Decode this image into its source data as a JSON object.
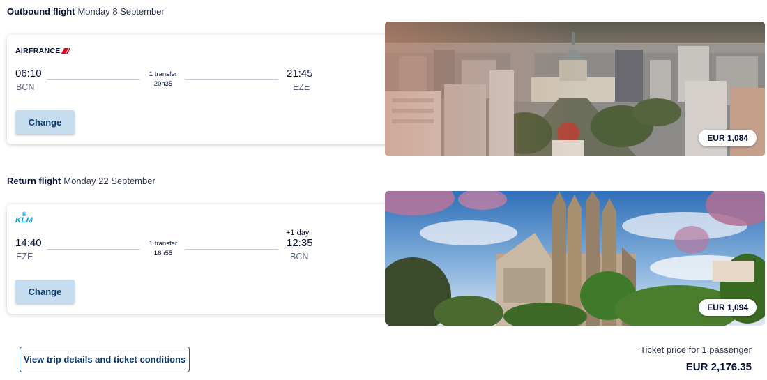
{
  "outbound": {
    "heading": "Outbound flight",
    "date": "Monday 8 September",
    "airline": "AIRFRANCE",
    "airline_icon": "airfrance-logo-icon",
    "depart_time": "06:10",
    "depart_code": "BCN",
    "transfer": "1 transfer",
    "duration": "20h35",
    "arrive_time": "21:45",
    "arrive_code": "EZE",
    "change_label": "Change",
    "price": "EUR 1,084"
  },
  "return": {
    "heading": "Return flight",
    "date": "Monday 22 September",
    "airline": "KLM",
    "airline_icon": "klm-logo-icon",
    "depart_time": "14:40",
    "depart_code": "EZE",
    "transfer": "1 transfer",
    "duration": "16h55",
    "plus_day": "+1 day",
    "arrive_time": "12:35",
    "arrive_code": "BCN",
    "change_label": "Change",
    "price": "EUR 1,094"
  },
  "footer": {
    "details_label": "View trip details and ticket conditions",
    "ticket_label": "Ticket price for 1 passenger",
    "total": "EUR 2,176.35"
  },
  "colors": {
    "navy": "#051039",
    "button_bg": "#c6dcef",
    "link_border": "#1b5a8c",
    "airfrance_red": "#e2001a",
    "klm_blue": "#00a1de"
  }
}
